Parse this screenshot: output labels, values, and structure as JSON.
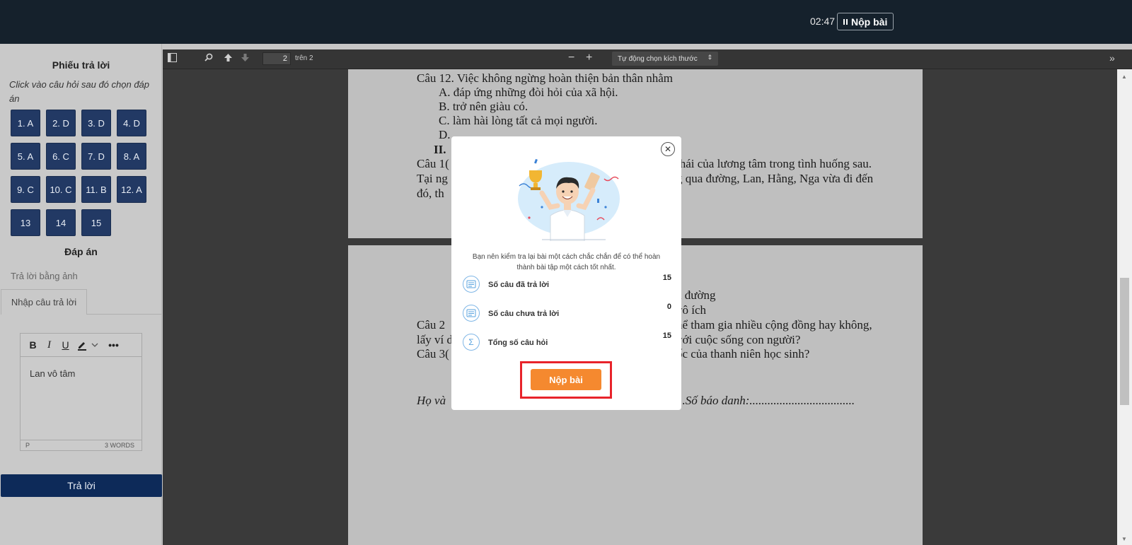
{
  "header": {
    "timer": "02:47",
    "submit_label": "Nộp bài"
  },
  "sidebar": {
    "title": "Phiếu trả lời",
    "instruction": "Click vào câu hỏi sau đó chọn đáp án",
    "questions": [
      "1. A",
      "2. D",
      "3. D",
      "4. D",
      "5. A",
      "6. C",
      "7. D",
      "8. A",
      "9. C",
      "10. C",
      "11. B",
      "12. A",
      "13",
      "14",
      "15"
    ],
    "answer_title": "Đáp án",
    "photo_answer_label": "Trả lời bằng ảnh",
    "input_tab_label": "Nhập câu trả lời",
    "editor": {
      "toolbar": [
        "B",
        "I",
        "U",
        "pen-icon",
        "chevron-down-icon",
        "more-icon"
      ],
      "text": "Lan vô tâm",
      "status_left": "P",
      "status_right": "3 WORDS"
    },
    "answer_button": "Trả lời"
  },
  "pdf_toolbar": {
    "page_number": "2",
    "page_total": "trên 2",
    "zoom_minus": "−",
    "zoom_plus": "+",
    "zoom_option": "Tự động chọn kích thước"
  },
  "document": {
    "page1": [
      "Câu 12. Việc không ngừng hoàn thiện bản thân nhằm",
      "A.  đáp ứng những đòi hỏi của xã hội.",
      "B. trở nên giàu có.",
      "C. làm hài lòng tất cả mọi người.",
      "D.",
      "II.",
      "Câu 1(",
      "thái của lương tâm trong tình huống sau.",
      "Tại ng",
      "g qua đường, Lan, Hằng, Nga vừa đi đến",
      "đó, th"
    ],
    "page2": [
      "a đường",
      "vô ích",
      "Câu 2",
      "hể tham gia nhiều cộng đồng hay không,",
      "lấy ví d",
      "với cuộc sống con người?",
      "Câu 3(",
      "ốc của thanh niên học sinh?",
      "Họ và",
      "...Số báo danh:..................................."
    ]
  },
  "modal": {
    "message": "Bạn nên kiểm tra lại bài một cách chắc chắn để có thể hoàn thành bài tập một cách tốt nhất.",
    "stats": [
      {
        "label": "Số câu đã trả lời",
        "value": "15"
      },
      {
        "label": "Số câu chưa trả lời",
        "value": "0"
      },
      {
        "label": "Tổng số câu hỏi",
        "value": "15"
      }
    ],
    "submit_label": "Nộp bài"
  }
}
